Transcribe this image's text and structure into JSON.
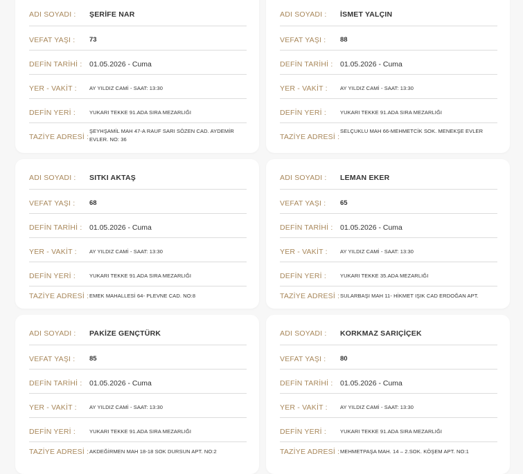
{
  "labels": {
    "name": "ADI SOYADI :",
    "age": "VEFAT YAŞI :",
    "date": "DEFİN TARİHİ :",
    "place_time": "YER - VAKİT :",
    "burial": "DEFİN YERİ :",
    "condolence": "TAZİYE ADRESİ :"
  },
  "records": [
    {
      "name": "ŞERİFE NAR",
      "age": "73",
      "date": "01.05.2026 - Cuma",
      "place_time": "AY YILDIZ CAMİ - SAAT: 13:30",
      "burial": "YUKARI TEKKE 91.ADA SIRA MEZARLIĞI",
      "condolence": "ŞEYHŞAMİL MAH 47-A RAUF SARI SÖZEN CAD. AYDEMİR EVLER. NO: 36"
    },
    {
      "name": "İSMET YALÇIN",
      "age": "88",
      "date": "01.05.2026 - Cuma",
      "place_time": "AY YILDIZ CAMİ - SAAT: 13:30",
      "burial": "YUKARI TEKKE 91.ADA SIRA MEZARLIĞI",
      "condolence": "SELÇUKLU MAH 66-MEHMETCİK SOK. MENEKŞE EVLER"
    },
    {
      "name": "SITKI AKTAŞ",
      "age": "68",
      "date": "01.05.2026 - Cuma",
      "place_time": "AY YILDIZ CAMİ - SAAT: 13:30",
      "burial": "YUKARI TEKKE 91.ADA SIRA MEZARLIĞI",
      "condolence": "EMEK MAHALLESİ 64- PLEVNE CAD. NO:8"
    },
    {
      "name": "LEMAN EKER",
      "age": "65",
      "date": "01.05.2026 - Cuma",
      "place_time": "AY YILDIZ CAMİ - SAAT: 13:30",
      "burial": "YUKARI TEKKE 35.ADA MEZARLIĞI",
      "condolence": "SULARBAŞI MAH 11- HİKMET IŞIK CAD ERDOĞAN APT."
    },
    {
      "name": "PAKİZE GENÇTÜRK",
      "age": "85",
      "date": "01.05.2026 - Cuma",
      "place_time": "AY YILDIZ CAMİ - SAAT: 13:30",
      "burial": "YUKARI TEKKE 91.ADA SIRA MEZARLIĞI",
      "condolence": "AKDEĞİRMEN MAH 18-18 SOK DURSUN APT. NO:2"
    },
    {
      "name": "KORKMAZ SARIÇİÇEK",
      "age": "80",
      "date": "01.05.2026 - Cuma",
      "place_time": "AY YILDIZ CAMİ - SAAT: 13:30",
      "burial": "YUKARI TEKKE 91.ADA SIRA MEZARLIĞI",
      "condolence": "MEHMETPAŞA MAH. 14 – 2.SOK. KÖŞEM APT. NO:1"
    }
  ]
}
